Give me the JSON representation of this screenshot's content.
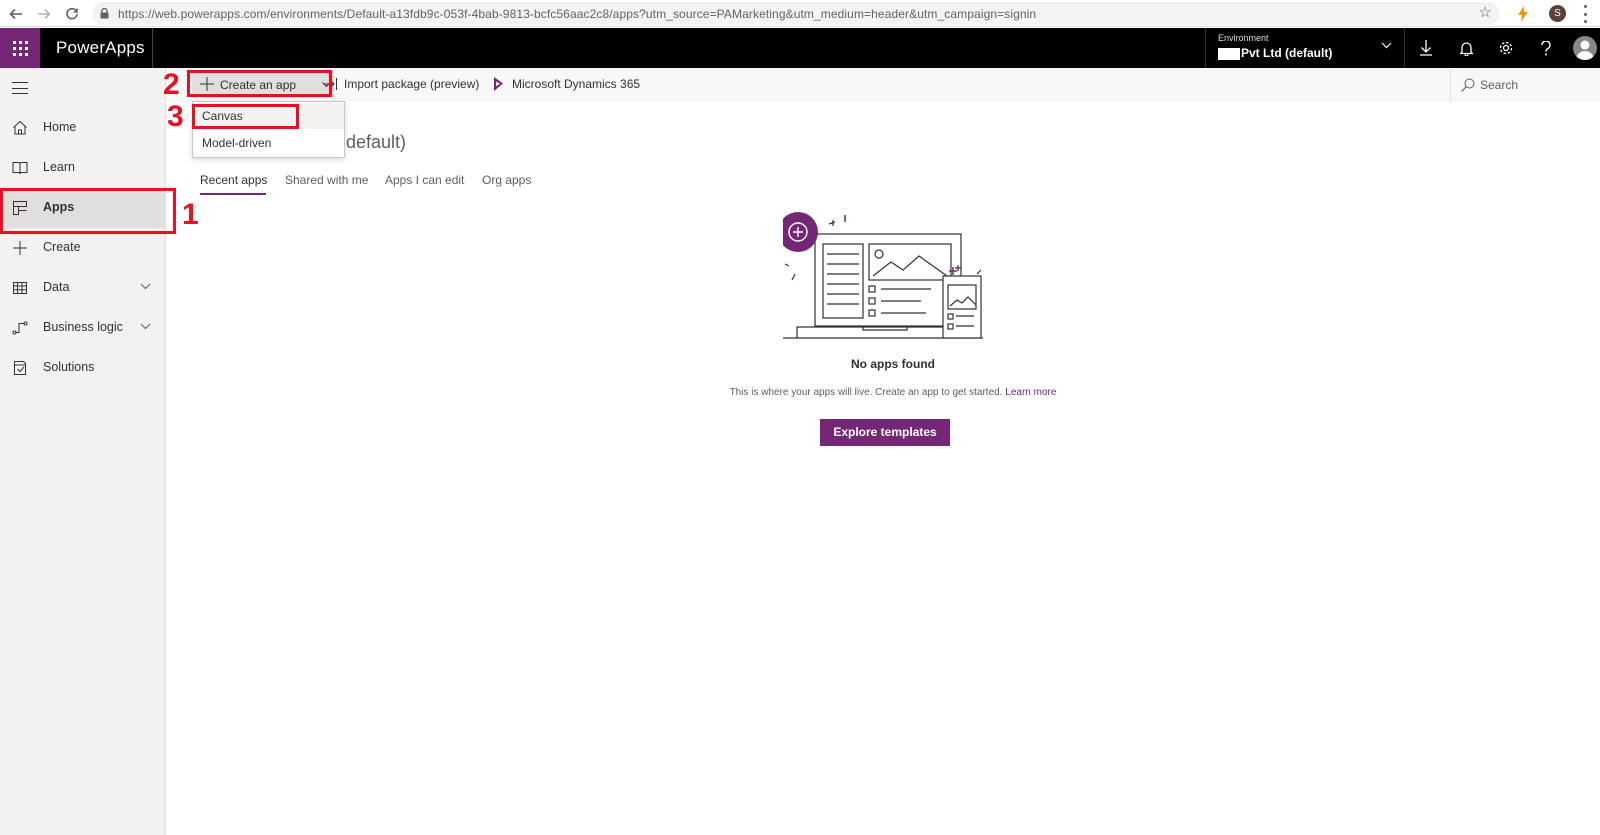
{
  "browser": {
    "url": "https://web.powerapps.com/environments/Default-a13fdb9c-053f-4bab-9813-bcfc56aac2c8/apps?utm_source=PAMarketing&utm_medium=header&utm_campaign=signin",
    "profile_initial": "S"
  },
  "header": {
    "app_title": "PowerApps",
    "environment_label": "Environment",
    "environment_value": "Pvt Ltd (default)",
    "brand_color": "#742774"
  },
  "sidebar": {
    "items": [
      {
        "label": "Home",
        "icon": "home-icon"
      },
      {
        "label": "Learn",
        "icon": "book-icon"
      },
      {
        "label": "Apps",
        "icon": "apps-icon",
        "selected": true
      },
      {
        "label": "Create",
        "icon": "plus-icon"
      },
      {
        "label": "Data",
        "icon": "table-icon",
        "expandable": true
      },
      {
        "label": "Business logic",
        "icon": "flow-icon",
        "expandable": true
      },
      {
        "label": "Solutions",
        "icon": "solutions-icon"
      }
    ]
  },
  "command_bar": {
    "create_label": "Create an app",
    "import_label": "Import package (preview)",
    "dynamics_label": "Microsoft Dynamics 365",
    "search_placeholder": "Search"
  },
  "create_menu": {
    "options": [
      "Canvas",
      "Model-driven"
    ]
  },
  "main": {
    "env_heading": "default)",
    "tabs": [
      "Recent apps",
      "Shared with me",
      "Apps I can edit",
      "Org apps"
    ],
    "active_tab": "Recent apps",
    "empty_title": "No apps found",
    "empty_desc": "This is where your apps will live. Create an app to get started.",
    "learn_more": "Learn more",
    "explore_button": "Explore templates"
  },
  "annotations": {
    "step1": "1",
    "step2": "2",
    "step3": "3",
    "color": "#e81123"
  }
}
